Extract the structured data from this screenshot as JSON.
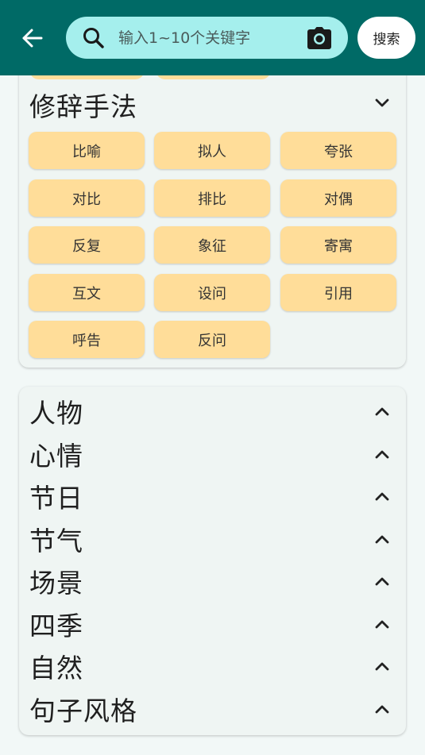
{
  "colors": {
    "topbar": "#006a66",
    "search_bg": "#a5efed",
    "chip_bg": "#ffdd99",
    "page_bg": "#f2f8f7",
    "card_bg": "#eff5f3"
  },
  "header": {
    "back_icon": "arrow-left-icon",
    "search": {
      "placeholder": "输入1~10个关键字",
      "value": "",
      "icon": "search-icon",
      "camera_icon": "camera-icon"
    },
    "search_button_label": "搜索"
  },
  "rhetoric": {
    "title": "修辞手法",
    "expanded": true,
    "chips": [
      "比喻",
      "拟人",
      "夸张",
      "对比",
      "排比",
      "对偶",
      "反复",
      "象征",
      "寄寓",
      "互文",
      "设问",
      "引用",
      "呼告",
      "反问"
    ]
  },
  "categories": [
    {
      "title": "人物"
    },
    {
      "title": "心情"
    },
    {
      "title": "节日"
    },
    {
      "title": "节气"
    },
    {
      "title": "场景"
    },
    {
      "title": "四季"
    },
    {
      "title": "自然"
    },
    {
      "title": "句子风格"
    }
  ]
}
